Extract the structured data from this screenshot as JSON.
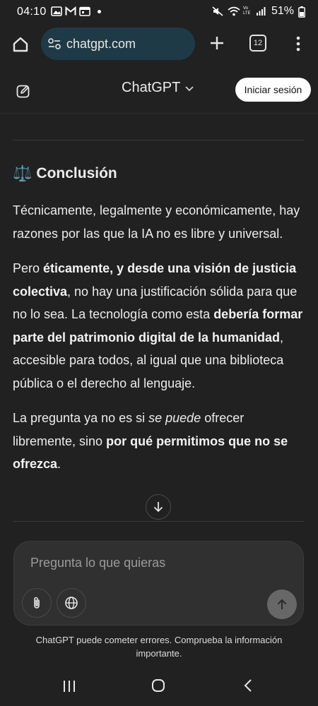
{
  "status_bar": {
    "time": "04:10",
    "battery": "51%",
    "left_icons": [
      "photo-icon",
      "gmail-icon",
      "calendar-icon",
      "dot-icon"
    ],
    "right_icons": [
      "mute-icon",
      "wifi-icon",
      "volte-icon",
      "signal-icon",
      "battery-icon"
    ],
    "volte_label": "Vo LTE"
  },
  "browser": {
    "url": "chatgpt.com",
    "tab_count": "12"
  },
  "app_bar": {
    "title": "ChatGPT",
    "login_label": "Iniciar sesión"
  },
  "content": {
    "heading_emoji": "⚖️",
    "heading": "Conclusión",
    "para1": "Técnicamente, legalmente y económicamente, hay razones por las que la IA no es libre y universal.",
    "para2": {
      "t1": "Pero ",
      "b1": "éticamente, y desde una visión de justicia colectiva",
      "t2": ", no hay una justificación sólida para que no lo sea. La tecnología como esta ",
      "b2": "debería formar parte del patrimonio digital de la humanidad",
      "t3": ", accesible para todos, al igual que una biblioteca pública o el derecho al lenguaje."
    },
    "para3": {
      "t1": "La pregunta ya no es si ",
      "i1": "se puede",
      "t2": " ofrecer libremente, sino ",
      "b1": "por qué permitimos que no se ofrezca",
      "t3": "."
    }
  },
  "composer": {
    "placeholder": "Pregunta lo que quieras"
  },
  "disclaimer": "ChatGPT puede cometer errores. Comprueba la información importante.",
  "colors": {
    "background": "#212121",
    "url_bar": "#1f3a47",
    "composer": "#303030",
    "send_button": "#676767",
    "login_button": "#ffffff"
  }
}
